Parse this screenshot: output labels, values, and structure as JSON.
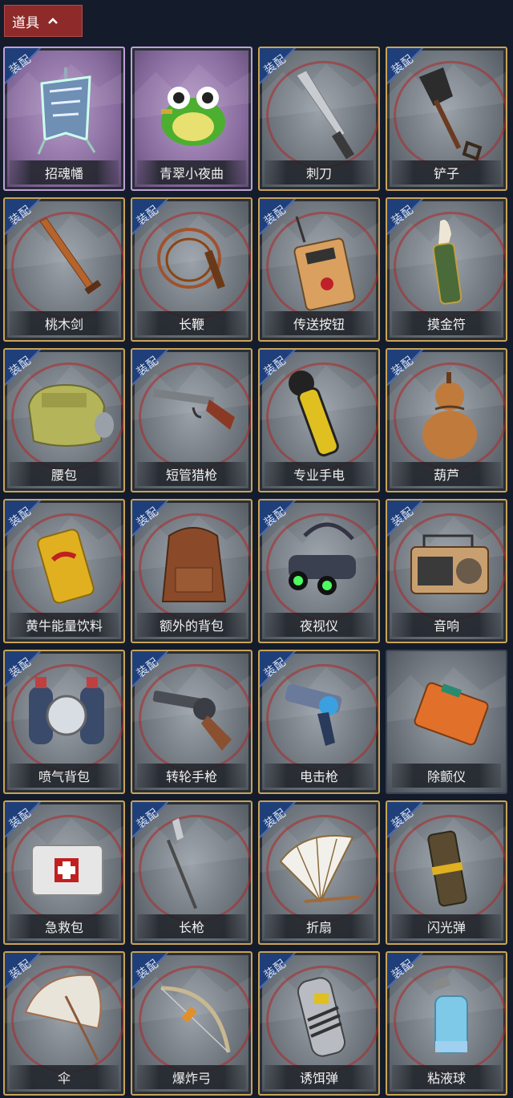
{
  "header": {
    "title": "道具"
  },
  "equip_label": "装配",
  "items": [
    {
      "name": "招魂幡",
      "icon": "soul-banner-icon",
      "style": "purple",
      "equip": true
    },
    {
      "name": "青翠小夜曲",
      "icon": "frog-toy-icon",
      "style": "purple",
      "equip": false
    },
    {
      "name": "刺刀",
      "icon": "bayonet-icon",
      "style": "gold",
      "equip": true
    },
    {
      "name": "铲子",
      "icon": "shovel-icon",
      "style": "gold",
      "equip": true
    },
    {
      "name": "桃木剑",
      "icon": "peachwood-sword-icon",
      "style": "gold",
      "equip": true
    },
    {
      "name": "长鞭",
      "icon": "whip-icon",
      "style": "gold",
      "equip": true
    },
    {
      "name": "传送按钮",
      "icon": "teleport-button-icon",
      "style": "gold",
      "equip": true
    },
    {
      "name": "摸金符",
      "icon": "talisman-icon",
      "style": "gold",
      "equip": true
    },
    {
      "name": "腰包",
      "icon": "waist-bag-icon",
      "style": "gold",
      "equip": true
    },
    {
      "name": "短管猎枪",
      "icon": "shotgun-icon",
      "style": "gold",
      "equip": true
    },
    {
      "name": "专业手电",
      "icon": "flashlight-icon",
      "style": "gold",
      "equip": true
    },
    {
      "name": "葫芦",
      "icon": "gourd-icon",
      "style": "gold",
      "equip": true
    },
    {
      "name": "黄牛能量饮料",
      "icon": "energy-drink-icon",
      "style": "gold",
      "equip": true
    },
    {
      "name": "额外的背包",
      "icon": "backpack-icon",
      "style": "gold",
      "equip": true
    },
    {
      "name": "夜视仪",
      "icon": "night-vision-icon",
      "style": "gold",
      "equip": true
    },
    {
      "name": "音响",
      "icon": "boombox-icon",
      "style": "gold",
      "equip": true
    },
    {
      "name": "喷气背包",
      "icon": "jetpack-icon",
      "style": "gold",
      "equip": true
    },
    {
      "name": "转轮手枪",
      "icon": "revolver-icon",
      "style": "gold",
      "equip": true
    },
    {
      "name": "电击枪",
      "icon": "shock-gun-icon",
      "style": "gold",
      "equip": true
    },
    {
      "name": "除颤仪",
      "icon": "defibrillator-icon",
      "style": "plain",
      "equip": false
    },
    {
      "name": "急救包",
      "icon": "first-aid-kit-icon",
      "style": "gold",
      "equip": true
    },
    {
      "name": "长枪",
      "icon": "spear-icon",
      "style": "gold",
      "equip": true
    },
    {
      "name": "折扇",
      "icon": "folding-fan-icon",
      "style": "gold",
      "equip": true
    },
    {
      "name": "闪光弹",
      "icon": "flashbang-icon",
      "style": "gold",
      "equip": true
    },
    {
      "name": "伞",
      "icon": "umbrella-icon",
      "style": "gold",
      "equip": true
    },
    {
      "name": "爆炸弓",
      "icon": "explosive-bow-icon",
      "style": "gold",
      "equip": true
    },
    {
      "name": "诱饵弹",
      "icon": "decoy-grenade-icon",
      "style": "gold",
      "equip": true
    },
    {
      "name": "粘液球",
      "icon": "slime-ball-icon",
      "style": "gold",
      "equip": true
    }
  ]
}
